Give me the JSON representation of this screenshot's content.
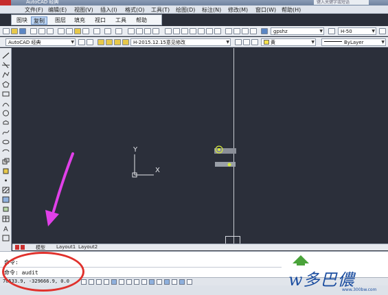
{
  "window": {
    "title": "AutoCAD 经典",
    "search_placeholder": "键入关键字或短语"
  },
  "menu": [
    "文件(F)",
    "编辑(E)",
    "视图(V)",
    "插入(I)",
    "格式(O)",
    "工具(T)",
    "绘图(D)",
    "标注(N)",
    "修改(M)",
    "窗口(W)",
    "帮助(H)"
  ],
  "ribbon_tabs": [
    "图块",
    "复制",
    "图层",
    "填充",
    "视口",
    "工具",
    "帮助"
  ],
  "toolbar2": {
    "workspace": "AutoCAD 经典",
    "layer": "H-2015.12.15意见修改",
    "style": "gpshz",
    "dim_style": "H-50",
    "color": "黄",
    "linetype": "ByLayer"
  },
  "layout_tabs": [
    "模型",
    "Layout1",
    "Layout2"
  ],
  "ucs": {
    "y": "Y",
    "x": "X"
  },
  "command": {
    "line1": "命令:",
    "line2": "命令: audit"
  },
  "status": {
    "coords": "70533.9,  -329666.9,  0.0"
  },
  "watermark": {
    "text": "w多巴儂",
    "url": "www.300bw.com"
  },
  "colors": {
    "canvas": "#2b2f3a",
    "annotation_circle": "#e0312c",
    "annotation_arrow": "#e040e8",
    "watermark": "#1c4ea0"
  }
}
